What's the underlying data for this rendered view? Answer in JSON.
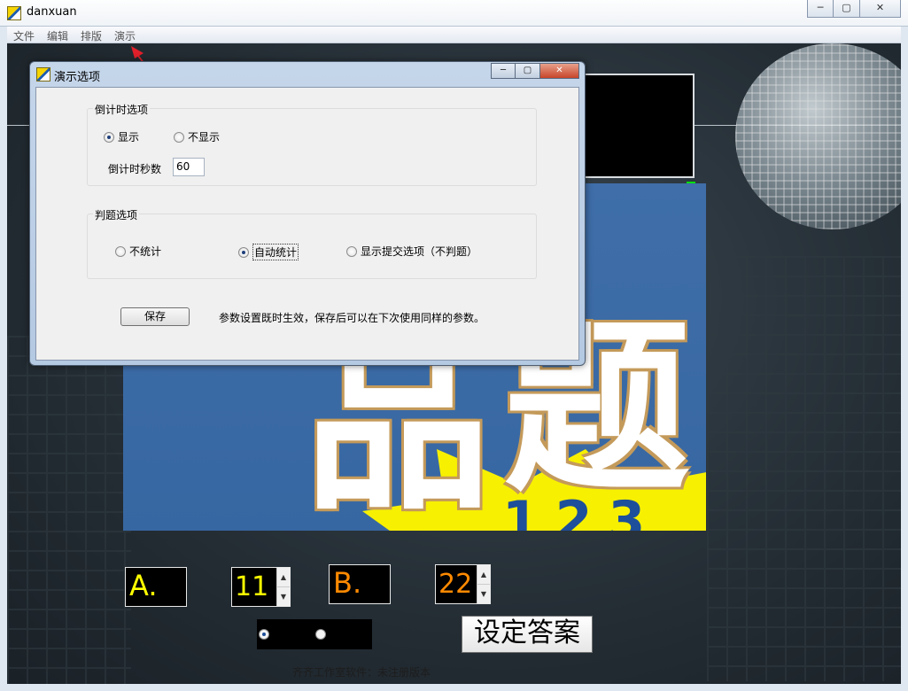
{
  "window": {
    "title": "danxuan",
    "minimize": "─",
    "maximize": "▢",
    "close": "✕"
  },
  "menu": [
    "文件",
    "编辑",
    "排版",
    "演示"
  ],
  "canvas": {
    "picture_chars": [
      "品",
      "题"
    ],
    "picture_digits": "123",
    "option_a_label": "A.",
    "option_a_value": "11",
    "option_b_label": "B.",
    "option_b_value": "22",
    "set_answer_label": "设定答案",
    "footer_note": "齐齐工作室软件：未注册版本",
    "colors": {
      "option_a": "#ffff00",
      "option_b": "#ff8a00",
      "green_handle": "#00e000"
    }
  },
  "dialog": {
    "title": "演示选项",
    "minimize": "─",
    "maximize": "▢",
    "close": "✕",
    "countdown_group": {
      "label": "倒计时选项",
      "show_label": "显示",
      "hide_label": "不显示",
      "selected": "show",
      "seconds_label": "倒计时秒数",
      "seconds_value": "60"
    },
    "judge_group": {
      "label": "判题选项",
      "no_stats_label": "不统计",
      "auto_stats_label": "自动统计",
      "show_submit_label": "显示提交选项（不判题）",
      "selected": "auto"
    },
    "save_label": "保存",
    "hint": "参数设置既时生效，保存后可以在下次使用同样的参数。"
  }
}
